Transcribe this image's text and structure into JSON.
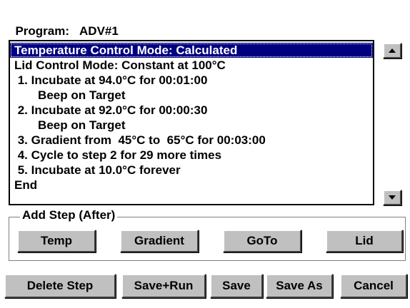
{
  "program": {
    "label": "Program:",
    "name": "ADV#1"
  },
  "steps_list": {
    "lines": [
      "Temperature Control Mode: Calculated",
      "Lid Control Mode: Constant at 100°C",
      " 1. Incubate at 94.0°C for 00:01:00",
      "       Beep on Target",
      " 2. Incubate at 92.0°C for 00:00:30",
      "       Beep on Target",
      " 3. Gradient from  45°C to  65°C for 00:03:00",
      " 4. Cycle to step 2 for 29 more times",
      " 5. Incubate at 10.0°C forever",
      "End"
    ],
    "selected_index": 0
  },
  "scrollbar": {
    "up_icon": "triangle-up-icon",
    "down_icon": "triangle-down-icon"
  },
  "add_step": {
    "legend": "Add Step (After)",
    "buttons": {
      "temp": "Temp",
      "gradient": "Gradient",
      "goto": "GoTo",
      "lid": "Lid"
    }
  },
  "actions": {
    "delete_step": "Delete Step",
    "save_run": "Save+Run",
    "save": "Save",
    "save_as": "Save As",
    "cancel": "Cancel"
  },
  "colors": {
    "selection_background": "#000080",
    "selection_text": "#ffffff",
    "button_face": "#c0c0c0"
  }
}
